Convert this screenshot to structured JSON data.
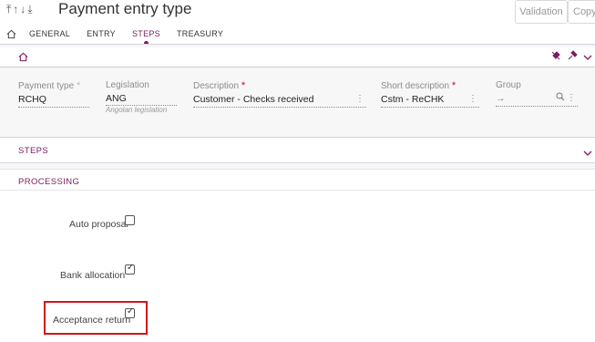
{
  "header": {
    "nav_arrows": "⤒↑↓⤓",
    "title": "Payment entry type",
    "validation_label": "Validation",
    "copy_label": "Copy"
  },
  "tabs": [
    {
      "label": "GENERAL"
    },
    {
      "label": "ENTRY"
    },
    {
      "label": "STEPS"
    },
    {
      "label": "TREASURY"
    }
  ],
  "fields": {
    "payment_type": {
      "label": "Payment type",
      "required_mark": "*",
      "value": "RCHQ"
    },
    "legislation": {
      "label": "Legislation",
      "value": "ANG",
      "sub": "Angolan legislation"
    },
    "description": {
      "label": "Description",
      "required_mark": "*",
      "value": "Customer - Checks received"
    },
    "short_description": {
      "label": "Short description",
      "required_mark": "*",
      "value": "Cstm - ReCHK"
    },
    "group": {
      "label": "Group",
      "value": "→"
    }
  },
  "sections": {
    "steps": "STEPS",
    "processing": "PROCESSING"
  },
  "processing": [
    {
      "label": "Auto proposal",
      "checked": false
    },
    {
      "label": "Bank allocation",
      "checked": true
    },
    {
      "label": "Acceptance return",
      "checked": true
    }
  ],
  "colors": {
    "accent": "#7a1b5e",
    "highlight": "#d4141a"
  }
}
